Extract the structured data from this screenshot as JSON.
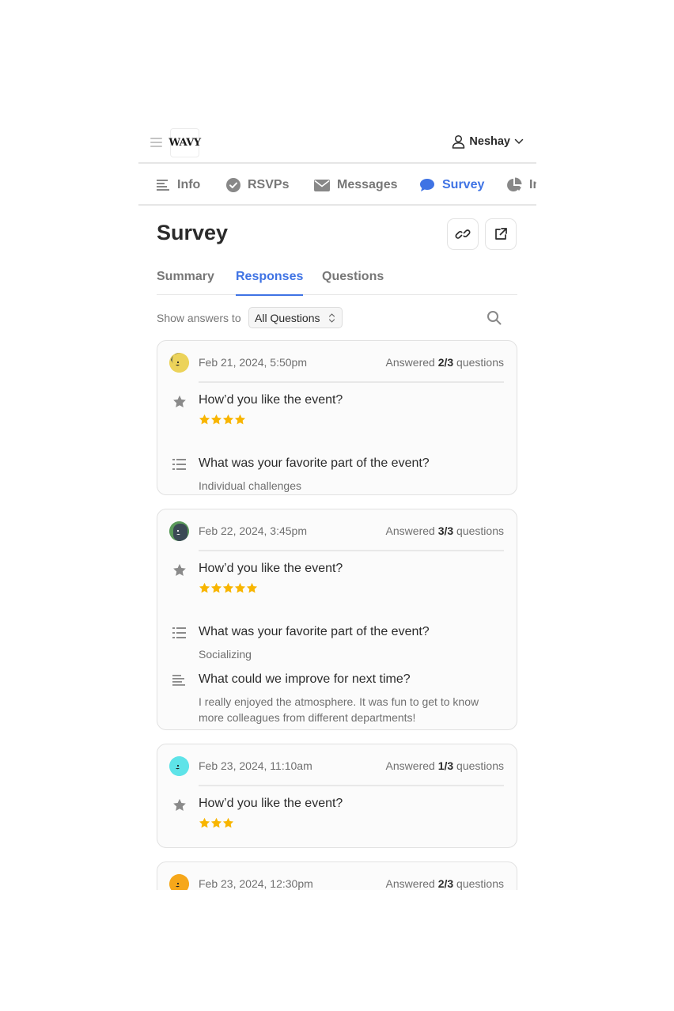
{
  "header": {
    "logo_text": "WAVY",
    "user_name": "Neshay"
  },
  "nav_tabs": [
    {
      "label": "Info",
      "icon": "text-align-left-icon",
      "active": false
    },
    {
      "label": "RSVPs",
      "icon": "check-circle-icon",
      "active": false
    },
    {
      "label": "Messages",
      "icon": "envelope-icon",
      "active": false
    },
    {
      "label": "Survey",
      "icon": "chat-bubble-icon",
      "active": true
    },
    {
      "label": "Insights",
      "icon": "pie-chart-icon",
      "active": false
    }
  ],
  "page": {
    "title": "Survey",
    "copy_link_icon": "link-icon",
    "open_external_icon": "external-link-icon"
  },
  "sub_tabs": [
    {
      "label": "Summary",
      "active": false
    },
    {
      "label": "Responses",
      "active": true
    },
    {
      "label": "Questions",
      "active": false
    }
  ],
  "filter": {
    "label": "Show answers to",
    "selected": "All Questions"
  },
  "colors": {
    "accent": "#3f73e4",
    "star": "#f8b500",
    "text": "#2b2b2b",
    "muted": "#6f6f6f"
  },
  "responses": [
    {
      "date": "Feb 21, 2024, 5:50pm",
      "answered_prefix": "Answered",
      "answered_count": "2/3",
      "answered_suffix": "questions",
      "avatar_color": "#ecd35a",
      "answers": [
        {
          "type": "rating",
          "question": "How’d you like the event?",
          "rating": 4,
          "max_rating": 5
        },
        {
          "type": "choice",
          "question": "What was your favorite part of the event?",
          "answer": "Individual challenges"
        }
      ]
    },
    {
      "date": "Feb 22, 2024, 3:45pm",
      "answered_prefix": "Answered",
      "answered_count": "3/3",
      "answered_suffix": "questions",
      "avatar_color": "#5a9a5a",
      "answers": [
        {
          "type": "rating",
          "question": "How’d you like the event?",
          "rating": 5,
          "max_rating": 5
        },
        {
          "type": "choice",
          "question": "What was your favorite part of the event?",
          "answer": "Socializing"
        },
        {
          "type": "text",
          "question": "What could we improve for next time?",
          "answer": "I really enjoyed the atmosphere. It was fun to get to know more colleagues from different departments!"
        }
      ]
    },
    {
      "date": "Feb 23, 2024, 11:10am",
      "answered_prefix": "Answered",
      "answered_count": "1/3",
      "answered_suffix": "questions",
      "avatar_color": "#5ee3e8",
      "answers": [
        {
          "type": "rating",
          "question": "How’d you like the event?",
          "rating": 3,
          "max_rating": 5
        }
      ]
    },
    {
      "date": "Feb 23, 2024, 12:30pm",
      "answered_prefix": "Answered",
      "answered_count": "2/3",
      "answered_suffix": "questions",
      "avatar_color": "#f6a71a",
      "answers": []
    }
  ]
}
